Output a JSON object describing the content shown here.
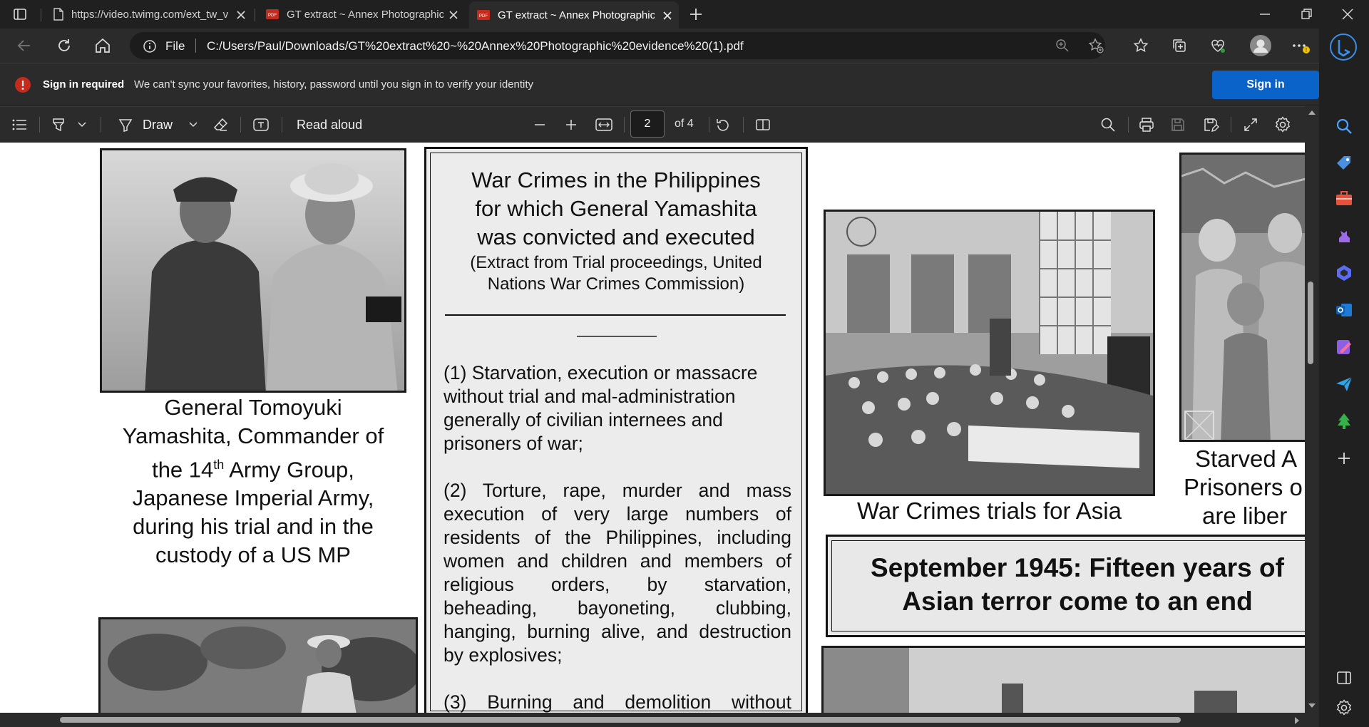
{
  "tabs": [
    {
      "title": "https://video.twimg.com/ext_tw_video/",
      "active": false
    },
    {
      "title": "GT extract ~ Annex Photographic evidence",
      "active": false
    },
    {
      "title": "GT extract ~ Annex Photographic evidence",
      "active": true
    }
  ],
  "address": {
    "scheme_label": "File",
    "url": "C:/Users/Paul/Downloads/GT%20extract%20~%20Annex%20Photographic%20evidence%20(1).pdf"
  },
  "infobar": {
    "title": "Sign in required",
    "message": "We can't sync your favorites, history, password until you sign in to verify your identity",
    "button": "Sign in"
  },
  "pdf_toolbar": {
    "draw_label": "Draw",
    "read_aloud_label": "Read aloud",
    "page_current": "2",
    "page_total_label": "of 4"
  },
  "page": {
    "caption_general": {
      "line1": "General Tomoyuki",
      "line2": "Yamashita, Commander of",
      "line3a": "the 14",
      "line3sup": "th",
      "line3b": " Army Group,",
      "line4": "Japanese Imperial Army,",
      "line5": "during his trial and in the",
      "line6": "custody of a US MP"
    },
    "box_title": {
      "line1": "War Crimes in the Philippines",
      "line2": "for which General Yamashita",
      "line3": "was convicted and executed",
      "sub1": "(Extract from Trial proceedings, United",
      "sub2": "Nations War Crimes Commission)"
    },
    "para1": [
      "(1) Starvation, execution or massacre",
      "without trial and mal-administration",
      "generally of civilian internees and",
      "prisoners of war;"
    ],
    "para2": [
      "(2) Torture, rape, murder and mass",
      "execution of very large numbers of",
      "residents of the Philippines, including",
      "women and children and members of",
      "religious orders, by starvation,",
      "beheading, bayoneting, clubbing,",
      "hanging, burning alive, and destruction",
      "by explosives;"
    ],
    "para3": [
      "(3) Burning and demolition without"
    ],
    "caption_trials": "War Crimes trials for Asia",
    "caption_starved": [
      "Starved A",
      "Prisoners o",
      "are liber"
    ],
    "banner": {
      "line1": "September 1945: Fifteen years of",
      "line2": "Asian terror come to an end"
    }
  },
  "colors": {
    "chrome_bg": "#202020",
    "toolbar_bg": "#2b2b2b",
    "signin_blue": "#0a63c9",
    "alert_red": "#c42b1c"
  }
}
